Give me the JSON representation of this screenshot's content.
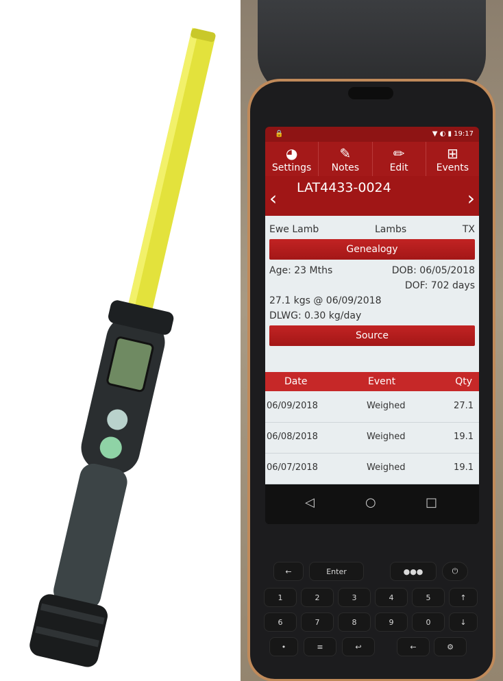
{
  "colors": {
    "wand_yellow": "#e1e03a",
    "app_red": "#a41919",
    "app_red_bright": "#c62828",
    "list_bg": "#e9eef0",
    "device_trim": "#c08a5a"
  },
  "status_bar": {
    "time": "19:17"
  },
  "toolbar": {
    "items": [
      {
        "label": "Settings",
        "icon": "settings-pie-icon"
      },
      {
        "label": "Notes",
        "icon": "notes-pen-plus-icon"
      },
      {
        "label": "Edit",
        "icon": "edit-pencil-icon"
      },
      {
        "label": "Events",
        "icon": "events-add-icon"
      }
    ]
  },
  "record": {
    "id": "LAT4433-0024",
    "prev_icon": "chevron-left-icon",
    "next_icon": "chevron-right-icon",
    "sex": "Ewe Lamb",
    "group": "Lambs",
    "code": "TX",
    "genealogy_label": "Genealogy",
    "age": "Age: 23 Mths",
    "dob": "DOB: 06/05/2018",
    "dof": "DOF: 702 days",
    "weight": "27.1 kgs @ 06/09/2018",
    "dlwg": "DLWG: 0.30 kg/day",
    "source_label": "Source"
  },
  "events_table": {
    "headers": [
      "Date",
      "Event",
      "Qty"
    ],
    "rows": [
      {
        "date": "06/09/2018",
        "event": "Weighed",
        "qty": "27.1"
      },
      {
        "date": "06/08/2018",
        "event": "Weighed",
        "qty": "19.1"
      },
      {
        "date": "06/07/2018",
        "event": "Weighed",
        "qty": "19.1"
      }
    ]
  },
  "nav_bar": {
    "back": "◁",
    "home": "○",
    "recents": "□"
  },
  "keypad": {
    "enter_label": "Enter",
    "dots_label": "●●●",
    "power_label": "⏻"
  }
}
